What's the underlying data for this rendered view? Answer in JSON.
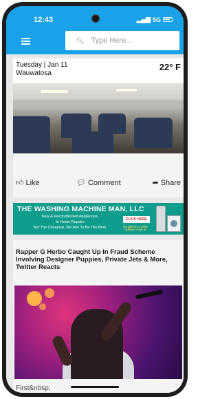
{
  "status_bar": {
    "time": "12:43",
    "network": "5G"
  },
  "header": {
    "search_placeholder": "Type Here..."
  },
  "weather": {
    "date": "Tuesday | Jan 11",
    "city": "Wauwatosa",
    "temperature": "22° F"
  },
  "post1": {
    "actions": {
      "like": "Like",
      "comment": "Comment",
      "share": "Share"
    }
  },
  "ad": {
    "headline": "THE WASHING MACHINE MAN, LLC",
    "line1": "New & Reconditioned Appliances,",
    "line2": "In Home Repairs",
    "line3": "Not The Cheapest, We Aim To Be The Best.",
    "button": "CLICK HERE",
    "notice": "WE ARE STILL OPEN DURING COVID 19"
  },
  "post2": {
    "title": "Rapper G Herbo Caught Up In Fraud Scheme Involving Designer Puppies, Private Jets & More, Twitter Reacts",
    "caption": "First&nbsp;"
  },
  "colors": {
    "brand": "#1aa2e8",
    "ad_bg": "#0e9c8c"
  }
}
